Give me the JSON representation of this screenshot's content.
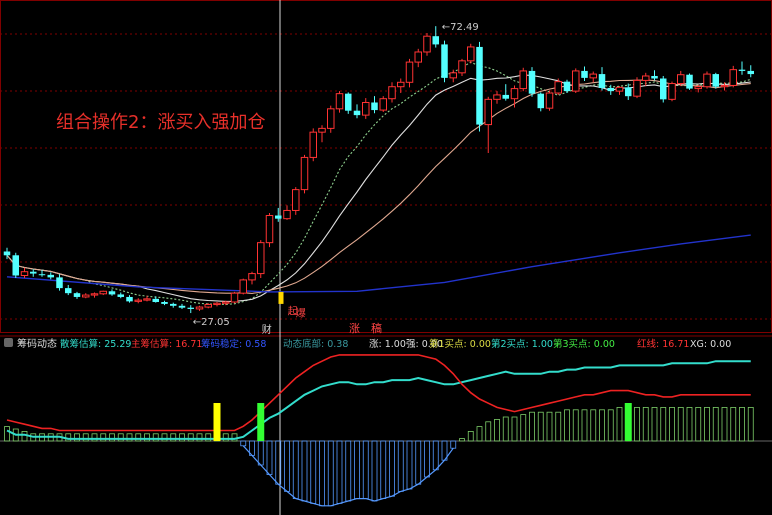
{
  "annotation": {
    "text": "组合操作2：涨买入强加仓",
    "color": "#e8302a"
  },
  "price_labels": {
    "high": "72.49",
    "low": "27.05"
  },
  "markers": {
    "start_top": "起",
    "start_bottom": "爆",
    "low_char": "财",
    "rise_char": "涨",
    "top_char": "稿"
  },
  "indicator": {
    "name": "筹码动态",
    "labels": [
      {
        "text": "散筹估算: 25.29",
        "color": "#33ddcc"
      },
      {
        "text": "主筹估算: 16.71",
        "color": "#ff3333"
      },
      {
        "text": "筹码稳定: 0.58",
        "color": "#3355ff"
      },
      {
        "text": "动态底部: 0.38",
        "color": "#3a9aa0"
      },
      {
        "text": "涨: 1.00",
        "color": "#dddddd"
      },
      {
        "text": "强: 0.00",
        "color": "#dddddd"
      },
      {
        "text": "第1买点: 0.00",
        "color": "#dddd44"
      },
      {
        "text": "第2买点: 1.00",
        "color": "#33ddcc"
      },
      {
        "text": "第3买点: 0.00",
        "color": "#44ee44"
      },
      {
        "text": "红线: 16.71",
        "color": "#ff3333"
      },
      {
        "text": "XG: 0.00",
        "color": "#dddddd"
      }
    ]
  },
  "colors": {
    "up": "#ff3333",
    "down": "#54ffff",
    "ma_short": "#e0e0e0",
    "ma_dash": "#8fd18f",
    "ma_mid": "#e0a890",
    "ma_long": "#2233cc",
    "grid": "#800000",
    "hist_up": "#7ecf6a",
    "hist_down": "#5599ff",
    "chip_cyan": "#33ddcc",
    "chip_red": "#ee2222",
    "signal_yellow": "#ffff00",
    "signal_green": "#33ff33"
  },
  "chart_data": {
    "type": "candlestick",
    "ylim": [
      25,
      76
    ],
    "candles": [
      [
        36.8,
        37.4,
        35.6,
        36.2
      ],
      [
        36.2,
        36.6,
        32.6,
        33.0
      ],
      [
        33.0,
        34.2,
        32.6,
        33.6
      ],
      [
        33.6,
        34.0,
        32.8,
        33.3
      ],
      [
        33.2,
        33.9,
        32.8,
        33.1
      ],
      [
        33.1,
        33.5,
        32.4,
        32.7
      ],
      [
        32.7,
        33.2,
        30.6,
        31.0
      ],
      [
        31.0,
        31.5,
        29.9,
        30.2
      ],
      [
        30.2,
        30.4,
        29.3,
        29.6
      ],
      [
        29.6,
        30.2,
        29.4,
        29.9
      ],
      [
        29.9,
        30.3,
        29.5,
        30.1
      ],
      [
        30.1,
        30.6,
        29.9,
        30.5
      ],
      [
        30.5,
        30.8,
        29.8,
        30.0
      ],
      [
        30.0,
        30.3,
        29.4,
        29.6
      ],
      [
        29.6,
        29.9,
        28.7,
        28.9
      ],
      [
        28.9,
        29.4,
        28.6,
        29.1
      ],
      [
        29.1,
        29.8,
        28.9,
        29.3
      ],
      [
        29.3,
        29.7,
        28.7,
        28.8
      ],
      [
        28.8,
        29.0,
        28.3,
        28.5
      ],
      [
        28.5,
        28.7,
        27.9,
        28.2
      ],
      [
        28.2,
        28.5,
        27.7,
        27.9
      ],
      [
        27.9,
        28.3,
        27.05,
        27.7
      ],
      [
        27.7,
        28.2,
        27.4,
        28.0
      ],
      [
        28.0,
        28.6,
        27.8,
        28.4
      ],
      [
        28.4,
        28.8,
        28.1,
        28.6
      ],
      [
        28.6,
        29.0,
        28.3,
        28.8
      ],
      [
        28.8,
        30.4,
        28.6,
        30.2
      ],
      [
        30.2,
        32.5,
        30.0,
        32.3
      ],
      [
        32.3,
        33.6,
        31.6,
        33.3
      ],
      [
        33.3,
        38.6,
        32.6,
        38.2
      ],
      [
        38.2,
        42.9,
        37.5,
        42.5
      ],
      [
        42.5,
        43.7,
        41.5,
        42.0
      ],
      [
        42.0,
        44.1,
        41.8,
        43.3
      ],
      [
        43.3,
        47.0,
        42.6,
        46.6
      ],
      [
        46.6,
        52.1,
        46.0,
        51.7
      ],
      [
        51.7,
        56.3,
        51.1,
        55.7
      ],
      [
        55.7,
        56.8,
        54.1,
        56.3
      ],
      [
        56.3,
        59.9,
        55.6,
        59.4
      ],
      [
        59.4,
        62.2,
        58.8,
        61.8
      ],
      [
        61.8,
        62.0,
        58.6,
        59.1
      ],
      [
        59.1,
        60.1,
        57.9,
        58.4
      ],
      [
        58.4,
        61.1,
        57.8,
        60.4
      ],
      [
        60.4,
        61.4,
        58.7,
        59.2
      ],
      [
        59.2,
        61.4,
        58.9,
        61.0
      ],
      [
        61.0,
        63.6,
        60.4,
        62.9
      ],
      [
        62.9,
        64.2,
        61.9,
        63.6
      ],
      [
        63.6,
        67.3,
        62.8,
        66.8
      ],
      [
        66.8,
        68.9,
        66.0,
        68.4
      ],
      [
        68.4,
        71.4,
        67.8,
        70.9
      ],
      [
        70.9,
        72.49,
        69.1,
        69.6
      ],
      [
        69.6,
        70.2,
        63.6,
        64.3
      ],
      [
        64.3,
        65.6,
        63.6,
        65.1
      ],
      [
        65.1,
        67.3,
        64.6,
        67.0
      ],
      [
        67.0,
        69.7,
        66.6,
        69.2
      ],
      [
        69.2,
        70.0,
        55.8,
        56.9
      ],
      [
        56.9,
        61.3,
        52.4,
        60.9
      ],
      [
        60.9,
        62.2,
        60.2,
        61.6
      ],
      [
        61.6,
        63.3,
        60.7,
        61.0
      ],
      [
        61.0,
        63.1,
        59.6,
        62.6
      ],
      [
        62.6,
        65.9,
        62.2,
        65.4
      ],
      [
        65.4,
        66.0,
        61.3,
        61.8
      ],
      [
        61.8,
        62.0,
        59.0,
        59.5
      ],
      [
        59.5,
        62.3,
        59.1,
        61.9
      ],
      [
        61.9,
        64.2,
        61.6,
        63.7
      ],
      [
        63.7,
        64.0,
        61.9,
        62.2
      ],
      [
        62.2,
        65.8,
        61.9,
        65.4
      ],
      [
        65.4,
        66.1,
        63.8,
        64.3
      ],
      [
        64.3,
        65.3,
        63.6,
        64.9
      ],
      [
        64.9,
        66.0,
        62.3,
        62.7
      ],
      [
        62.7,
        63.2,
        61.6,
        62.2
      ],
      [
        62.2,
        63.0,
        61.6,
        62.8
      ],
      [
        62.8,
        63.4,
        60.8,
        61.4
      ],
      [
        61.4,
        64.4,
        61.1,
        63.9
      ],
      [
        63.9,
        65.1,
        63.0,
        64.6
      ],
      [
        64.6,
        65.5,
        63.9,
        64.2
      ],
      [
        64.2,
        64.6,
        60.4,
        60.9
      ],
      [
        60.9,
        63.7,
        60.6,
        63.4
      ],
      [
        63.4,
        65.4,
        63.0,
        64.8
      ],
      [
        64.8,
        65.0,
        62.4,
        62.6
      ],
      [
        62.6,
        63.2,
        62.0,
        62.9
      ],
      [
        62.9,
        65.3,
        62.6,
        64.9
      ],
      [
        64.9,
        65.1,
        62.6,
        62.9
      ],
      [
        62.9,
        63.6,
        62.3,
        63.1
      ],
      [
        63.1,
        66.2,
        62.8,
        65.6
      ],
      [
        65.6,
        66.9,
        64.8,
        65.4
      ],
      [
        65.4,
        66.3,
        64.4,
        64.9
      ]
    ],
    "ma_long": [
      [
        0,
        32.8
      ],
      [
        15,
        31.2
      ],
      [
        30,
        30.4
      ],
      [
        40,
        30.5
      ],
      [
        50,
        31.9
      ],
      [
        60,
        34.4
      ],
      [
        70,
        36.6
      ],
      [
        77,
        38.0
      ],
      [
        85,
        39.4
      ]
    ],
    "chip_cyan_line": [
      5,
      3,
      3,
      2,
      2,
      2,
      2,
      1,
      1,
      1,
      1,
      1,
      1,
      1,
      1,
      1,
      1,
      1,
      1,
      1,
      1,
      1,
      1,
      1,
      1,
      1,
      1,
      2,
      5,
      8,
      11,
      13,
      16,
      19,
      22,
      24,
      26,
      27,
      28,
      28,
      27,
      27,
      28,
      28,
      29,
      29,
      29,
      30,
      29,
      28,
      27,
      27,
      28,
      29,
      30,
      31,
      32,
      33,
      32,
      32,
      32,
      32,
      33,
      33,
      34,
      34,
      35,
      35,
      35,
      35,
      36,
      36,
      36,
      36,
      36,
      36,
      37,
      37,
      37,
      37,
      37,
      38,
      38,
      38,
      38,
      38
    ],
    "chip_red_line": [
      10,
      9,
      8,
      7,
      6,
      6,
      5,
      5,
      5,
      5,
      5,
      5,
      5,
      5,
      5,
      5,
      5,
      5,
      5,
      5,
      5,
      5,
      5,
      5,
      5,
      5,
      5,
      7,
      10,
      14,
      18,
      22,
      26,
      30,
      33,
      36,
      38,
      40,
      41,
      41,
      41,
      41,
      41,
      41,
      41,
      41,
      41,
      41,
      40,
      39,
      36,
      32,
      27,
      23,
      20,
      18,
      16,
      15,
      14,
      15,
      16,
      17,
      18,
      19,
      20,
      21,
      22,
      22,
      23,
      24,
      24,
      24,
      23,
      22,
      22,
      21,
      21,
      22,
      22,
      22,
      22,
      22,
      22,
      22,
      22,
      22
    ],
    "histogram": [
      6,
      5,
      4,
      3,
      3,
      3,
      3,
      3,
      3,
      3,
      3,
      3,
      3,
      3,
      3,
      3,
      3,
      3,
      3,
      3,
      3,
      3,
      3,
      3,
      3,
      3,
      3,
      -2,
      -6,
      -10,
      -14,
      -18,
      -21,
      -24,
      -25,
      -26,
      -27,
      -27,
      -26,
      -25,
      -24,
      -24,
      -25,
      -24,
      -23,
      -21,
      -20,
      -18,
      -15,
      -12,
      -8,
      -3,
      1,
      4,
      6,
      8,
      9,
      10,
      10,
      11,
      12,
      12,
      12,
      12,
      13,
      13,
      13,
      13,
      13,
      13,
      14,
      14,
      14,
      14,
      14,
      14,
      14,
      14,
      14,
      14,
      14,
      14,
      14,
      14,
      14,
      14
    ],
    "signals": [
      {
        "index": 24,
        "type": "buy1",
        "color": "#ffff00"
      },
      {
        "index": 29,
        "type": "buy3",
        "color": "#33ff33"
      },
      {
        "index": 71,
        "type": "buy3",
        "color": "#33ff33"
      }
    ]
  }
}
